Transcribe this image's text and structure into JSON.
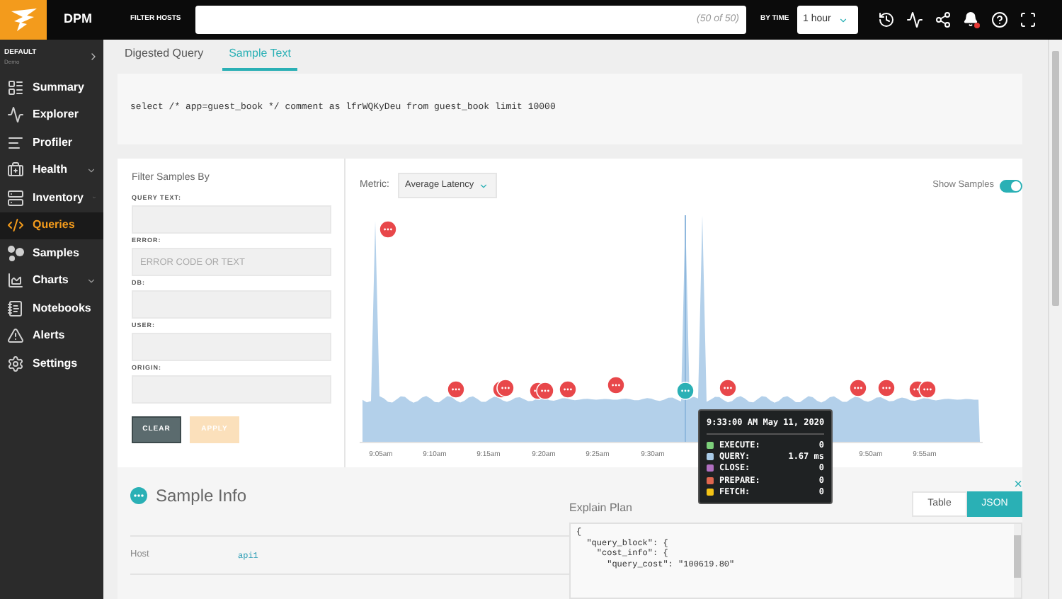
{
  "topbar": {
    "product": "DPM",
    "filter_label": "FILTER HOSTS",
    "filter_count": "(50 of 50)",
    "time_label": "BY TIME",
    "time_value": "1 hour"
  },
  "sidebar": {
    "scope_title": "DEFAULT",
    "scope_sub": "Demo",
    "items": [
      {
        "label": "Summary",
        "kind": "summary",
        "selected": false,
        "expandable": false
      },
      {
        "label": "Explorer",
        "kind": "explorer",
        "selected": false,
        "expandable": false
      },
      {
        "label": "Profiler",
        "kind": "profiler",
        "selected": false,
        "expandable": false
      },
      {
        "label": "Health",
        "kind": "health",
        "selected": false,
        "expandable": true
      },
      {
        "label": "Inventory",
        "kind": "inventory",
        "selected": false,
        "expandable": true
      },
      {
        "label": "Queries",
        "kind": "queries",
        "selected": true,
        "expandable": false
      },
      {
        "label": "Samples",
        "kind": "samples",
        "selected": false,
        "expandable": false
      },
      {
        "label": "Charts",
        "kind": "charts",
        "selected": false,
        "expandable": true
      },
      {
        "label": "Notebooks",
        "kind": "notebooks",
        "selected": false,
        "expandable": false
      },
      {
        "label": "Alerts",
        "kind": "alerts",
        "selected": false,
        "expandable": false
      },
      {
        "label": "Settings",
        "kind": "settings",
        "selected": false,
        "expandable": false
      }
    ]
  },
  "tabs": [
    {
      "label": "Digested Query",
      "selected": false
    },
    {
      "label": "Sample Text",
      "selected": true
    }
  ],
  "query_text": "select /* app=guest_book */ comment as lfrWQKyDeu from guest_book limit 10000",
  "filters": {
    "title": "Filter Samples By",
    "fields": [
      {
        "label": "QUERY TEXT:"
      },
      {
        "label": "ERROR:",
        "placeholder": "ERROR CODE OR TEXT"
      },
      {
        "label": "DB:"
      },
      {
        "label": "USER:"
      },
      {
        "label": "ORIGIN:"
      }
    ],
    "buttons": [
      {
        "label": "CLEAR",
        "disabled": false
      },
      {
        "label": "APPLY",
        "disabled": true
      }
    ]
  },
  "chart": {
    "metric_label": "Metric:",
    "metric_value": "Average Latency",
    "show_samples_label": "Show Samples",
    "show_samples_on": true,
    "x_ticks": [
      "9:05am",
      "9:10am",
      "9:15am",
      "9:20am",
      "9:25am",
      "9:30am",
      "9:50am",
      "9:55am"
    ],
    "samples": [
      {
        "selected": false
      },
      {
        "selected": false
      },
      {
        "selected": false
      },
      {
        "selected": false
      },
      {
        "selected": false
      },
      {
        "selected": false
      },
      {
        "selected": false
      },
      {
        "selected": false
      },
      {
        "selected": true
      },
      {
        "selected": false
      },
      {
        "selected": false
      },
      {
        "selected": false
      },
      {
        "selected": false
      },
      {
        "selected": false
      }
    ],
    "tooltip": {
      "title": "9:33:00 AM May 11, 2020",
      "rows": [
        {
          "name": "EXECUTE:",
          "value": "0",
          "color": "#7ccf7a"
        },
        {
          "name": "QUERY:",
          "value": "1.67 ms",
          "color": "#a9cbe8"
        },
        {
          "name": "CLOSE:",
          "value": "0",
          "color": "#b06fc0"
        },
        {
          "name": "PREPARE:",
          "value": "0",
          "color": "#e0674f"
        },
        {
          "name": "FETCH:",
          "value": "0",
          "color": "#f3c316"
        }
      ]
    }
  },
  "sample_info": {
    "title": "Sample Info",
    "rows": [
      {
        "label": "Host",
        "value": "api1"
      }
    ],
    "explain": {
      "title": "Explain Plan",
      "views": [
        {
          "label": "Table",
          "selected": false
        },
        {
          "label": "JSON",
          "selected": true
        }
      ],
      "close": "×",
      "lines": [
        "{",
        "  \"query_block\": {",
        "    \"cost_info\": {",
        "      \"query_cost\": \"100619.80\""
      ]
    }
  }
}
